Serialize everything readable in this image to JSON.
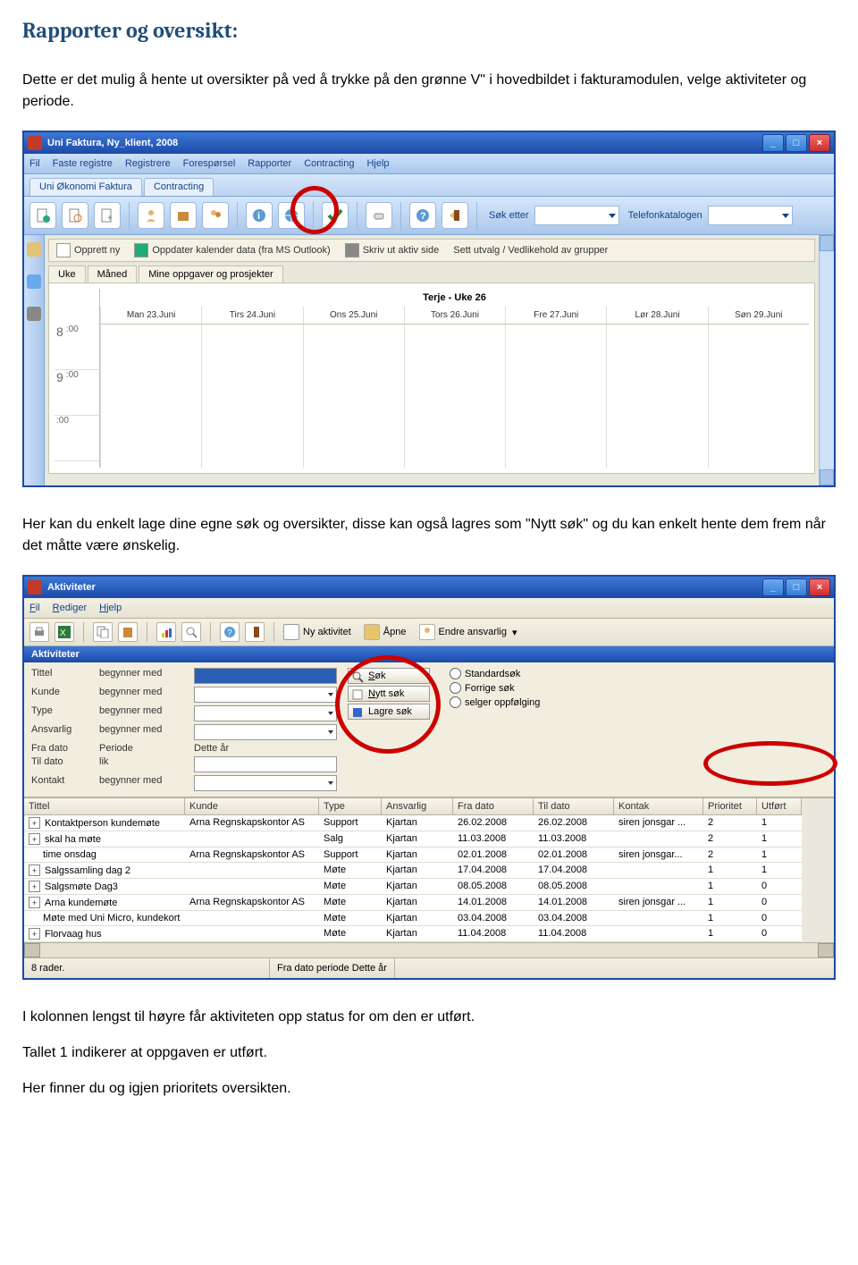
{
  "heading": "Rapporter og oversikt:",
  "para1": "Dette er det mulig å hente ut oversikter på ved å trykke på den grønne V\" i hovedbildet i fakturamodulen, velge aktiviteter og periode.",
  "para2": "Her kan du enkelt lage dine egne søk og oversikter, disse kan også lagres som \"Nytt søk\" og du kan enkelt hente dem frem når det måtte være ønskelig.",
  "para3a": "I kolonnen lengst til høyre får aktiviteten opp status for om den er utført.",
  "para3b": "Tallet 1 indikerer at oppgaven er utført.",
  "para3c": "Her finner du og igjen prioritets oversikten.",
  "ss1": {
    "title": "Uni Faktura, Ny_klient, 2008",
    "menus": [
      "Fil",
      "Faste registre",
      "Registrere",
      "Forespørsel",
      "Rapporter",
      "Contracting",
      "Hjelp"
    ],
    "tabs": [
      "Uni Økonomi Faktura",
      "Contracting"
    ],
    "toolbarRight": {
      "sok": "Søk etter",
      "tel": "Telefonkatalogen"
    },
    "subtoolbar": [
      "Opprett ny",
      "Oppdater kalender data (fra MS Outlook)",
      "Skriv ut aktiv side",
      "Sett utvalg / Vedlikehold av grupper"
    ],
    "tabs2": [
      "Uke",
      "Måned",
      "Mine oppgaver og prosjekter"
    ],
    "calTitle": "Terje - Uke 26",
    "days": [
      "Man 23.Juni",
      "Tirs 24.Juni",
      "Ons 25.Juni",
      "Tors 26.Juni",
      "Fre 27.Juni",
      "Lør 28.Juni",
      "Søn 29.Juni"
    ],
    "hours": [
      "8",
      "9"
    ],
    "min": ":00"
  },
  "ss2": {
    "title": "Aktiviteter",
    "menus": [
      "Fil",
      "Rediger",
      "Hjelp"
    ],
    "toolbar": {
      "ny": "Ny aktivitet",
      "apne": "Åpne",
      "endre": "Endre ansvarlig"
    },
    "hdr": "Aktiviteter",
    "filters": {
      "rows": [
        {
          "label": "Tittel",
          "op": "begynner med"
        },
        {
          "label": "Kunde",
          "op": "begynner med"
        },
        {
          "label": "Type",
          "op": "begynner med"
        },
        {
          "label": "Ansvarlig",
          "op": "begynner med"
        },
        {
          "label": "Fra dato",
          "op": "Periode",
          "val": "Dette år"
        },
        {
          "label": "Til dato",
          "op": "lik"
        },
        {
          "label": "Kontakt",
          "op": "begynner med"
        }
      ]
    },
    "buttons": {
      "sok": "Søk",
      "nytt": "Nytt søk",
      "lagre": "Lagre søk"
    },
    "sokRadios": [
      "Standardsøk",
      "Forrige søk",
      "selger oppfølging"
    ],
    "columns": [
      "Tittel",
      "Kunde",
      "Type",
      "Ansvarlig",
      "Fra dato",
      "Til dato",
      "Kontak",
      "Prioritet",
      "Utført"
    ],
    "rows": [
      {
        "exp": true,
        "title": "Kontaktperson kundemøte",
        "kunde": "Arna Regnskapskontor AS",
        "type": "Support",
        "ansv": "Kjartan",
        "fra": "26.02.2008",
        "til": "26.02.2008",
        "kontakt": "siren jonsgar ...",
        "pri": "2",
        "utf": "1"
      },
      {
        "exp": true,
        "title": "skal ha møte",
        "kunde": "",
        "type": "Salg",
        "ansv": "Kjartan",
        "fra": "11.03.2008",
        "til": "11.03.2008",
        "kontakt": "",
        "pri": "2",
        "utf": "1"
      },
      {
        "exp": false,
        "title": "time onsdag",
        "kunde": "Arna Regnskapskontor AS",
        "type": "Support",
        "ansv": "Kjartan",
        "fra": "02.01.2008",
        "til": "02.01.2008",
        "kontakt": "siren jonsgar...",
        "pri": "2",
        "utf": "1"
      },
      {
        "exp": true,
        "title": "Salgssamling dag 2",
        "kunde": "",
        "type": "Møte",
        "ansv": "Kjartan",
        "fra": "17.04.2008",
        "til": "17.04.2008",
        "kontakt": "",
        "pri": "1",
        "utf": "1"
      },
      {
        "exp": true,
        "title": "Salgsmøte Dag3",
        "kunde": "",
        "type": "Møte",
        "ansv": "Kjartan",
        "fra": "08.05.2008",
        "til": "08.05.2008",
        "kontakt": "",
        "pri": "1",
        "utf": "0"
      },
      {
        "exp": true,
        "title": "Arna kundemøte",
        "kunde": "Arna Regnskapskontor AS",
        "type": "Møte",
        "ansv": "Kjartan",
        "fra": "14.01.2008",
        "til": "14.01.2008",
        "kontakt": "siren jonsgar ...",
        "pri": "1",
        "utf": "0"
      },
      {
        "exp": false,
        "title": "Møte med Uni Micro, kundekort",
        "kunde": "",
        "type": "Møte",
        "ansv": "Kjartan",
        "fra": "03.04.2008",
        "til": "03.04.2008",
        "kontakt": "",
        "pri": "1",
        "utf": "0"
      },
      {
        "exp": true,
        "title": "Florvaag hus",
        "kunde": "",
        "type": "Møte",
        "ansv": "Kjartan",
        "fra": "11.04.2008",
        "til": "11.04.2008",
        "kontakt": "",
        "pri": "1",
        "utf": "0"
      }
    ],
    "status": {
      "left": "8 rader.",
      "right": "Fra dato periode Dette år"
    }
  }
}
